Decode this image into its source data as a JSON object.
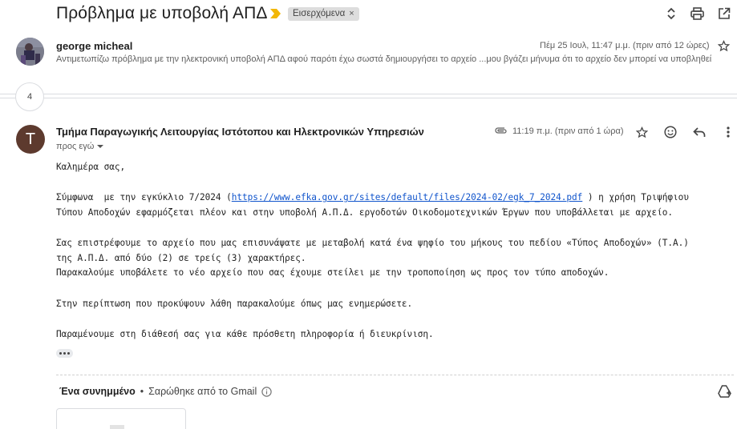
{
  "thread": {
    "subject": "Πρόβλημα με υποβολή ΑΠΔ",
    "label": "Εισερχόμενα",
    "label_remove": "×",
    "collapsed_count": "4"
  },
  "message1": {
    "sender": "george micheal",
    "date": "Πέμ 25 Ιουλ, 11:47 μ.μ. (πριν από 12 ώρες)",
    "snippet": "Αντιμετωπίζω πρόβλημα με την ηλεκτρονική υποβολή ΑΠΔ αφού παρότι έχω σωστά δημιουργήσει το αρχείο ...μου βγάζει μήνυμα ότι το αρχείο δεν μπορεί να υποβληθεί"
  },
  "message2": {
    "avatar_letter": "T",
    "sender": "Τμήμα Παραγωγικής Λειτουργίας Ιστότοπου και Ηλεκτρονικών Υπηρεσιών",
    "to": "προς εγώ",
    "date": "11:19 π.μ. (πριν από 1 ώρα)",
    "body": {
      "greeting": "Καλημέρα σας,",
      "p1_a": "Σύμφωνα  με την εγκύκλιο 7/2024 (",
      "p1_link": "https://www.efka.gov.gr/sites/default/files/2024-02/egk_7_2024.pdf",
      "p1_b": " ) η χρήση Τριψήφιου",
      "p1_c": "Τύπου Αποδοχών εφαρμόζεται πλέον και στην υποβολή Α.Π.Δ. εργοδοτών Οικοδομοτεχνικών Έργων που υποβάλλεται με αρχείο.",
      "p2_a": "Σας επιστρέφουμε το αρχείο που μας επισυνάψατε με μεταβολή κατά ένα ψηφίο του μήκους του πεδίου «Τύπος Αποδοχών» (Τ.Α.)",
      "p2_b": "της Α.Π.Δ. από δύο (2) σε τρείς (3) χαρακτήρες.",
      "p2_c": "Παρακαλούμε υποβάλετε το νέο αρχείο που σας έχουμε στείλει με την τροποποίηση ως προς τον τύπο αποδοχών.",
      "p3": "Στην περίπτωση που προκύψουν λάθη παρακαλούμε όπως μας ενημερώσετε.",
      "p4": "Παραμένουμε στη διάθεσή σας για κάθε πρόσθετη πληροφορία ή διευκρίνιση."
    },
    "attachments": {
      "title": "Ένα συνημμένο",
      "separator": "•",
      "scan_note": "Σαρώθηκε από το Gmail"
    }
  },
  "colors": {
    "link": "#1155cc",
    "importance_marker": "#f2b706",
    "avatar_t": "#5d3a2e",
    "label_chip": "#dddddd"
  },
  "icons": {
    "header": [
      "expand-collapse-icon",
      "print-icon",
      "open-new-window-icon"
    ],
    "message_actions": [
      "star-icon",
      "emoji-icon",
      "reply-icon",
      "more-vert-icon"
    ]
  }
}
